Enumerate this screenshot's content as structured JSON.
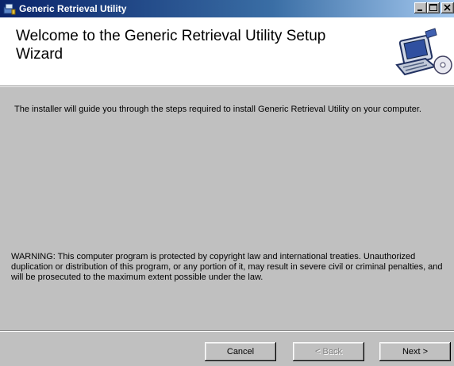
{
  "window": {
    "title": "Generic Retrieval Utility",
    "icons": {
      "app": "installer-icon",
      "minimize": "minimize-icon",
      "maximize": "maximize-icon",
      "close": "close-icon"
    }
  },
  "banner": {
    "title": "Welcome to the Generic Retrieval Utility Setup Wizard",
    "graphic": "computer-setup-graphic"
  },
  "body": {
    "intro": "The installer will guide you through the steps required to install Generic Retrieval Utility on your computer.",
    "warning": "WARNING: This computer program is protected by copyright law and international treaties. Unauthorized duplication or distribution of this program, or any portion of it, may result in severe civil or criminal penalties, and will be prosecuted to the maximum extent possible under the law."
  },
  "buttons": {
    "cancel": "Cancel",
    "back": "< Back",
    "next": "Next >"
  },
  "colors": {
    "titlebar_start": "#0a246a",
    "titlebar_end": "#a6caf0",
    "face": "#c0c0c0"
  }
}
